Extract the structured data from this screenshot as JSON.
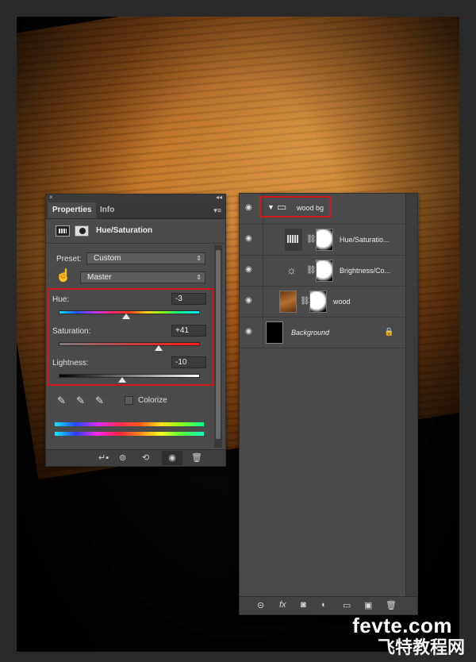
{
  "properties_panel": {
    "close": "×",
    "collapse": "◂◂",
    "tabs": [
      {
        "label": "Properties"
      },
      {
        "label": "Info"
      }
    ],
    "menu_icon": "menu-icon",
    "title": "Hue/Saturation",
    "preset": {
      "label": "Preset:",
      "value": "Custom"
    },
    "channel": {
      "value": "Master"
    },
    "sliders": {
      "hue": {
        "label": "Hue:",
        "value": "-3",
        "position": 0.48
      },
      "saturation": {
        "label": "Saturation:",
        "value": "+41",
        "position": 0.71
      },
      "lightness": {
        "label": "Lightness:",
        "value": "-10",
        "position": 0.45
      }
    },
    "colorize": {
      "label": "Colorize",
      "checked": false
    },
    "highlight_color": "#d1171a"
  },
  "layers_panel": {
    "layers": [
      {
        "name": "wood bg",
        "type": "group",
        "expanded": true
      },
      {
        "name": "Hue/Saturatio...",
        "type": "adjustment"
      },
      {
        "name": "Brightness/Co...",
        "type": "adjustment"
      },
      {
        "name": "wood",
        "type": "pixel"
      },
      {
        "name": "Background",
        "type": "background",
        "locked": true
      }
    ]
  },
  "watermark": {
    "primary": "fevte.com",
    "secondary": "飞特教程网"
  }
}
